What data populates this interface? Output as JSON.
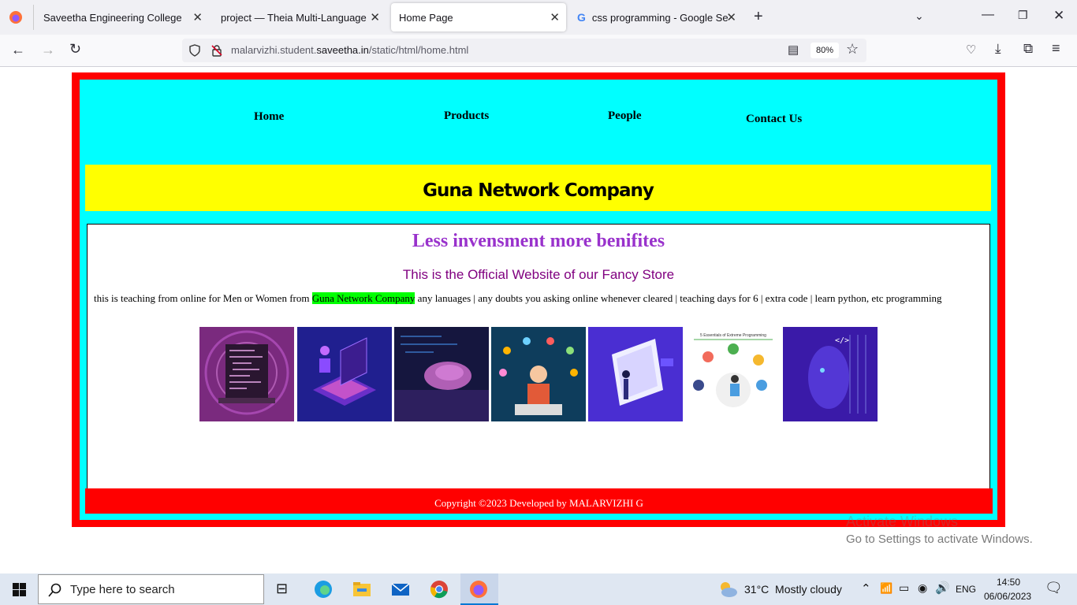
{
  "browser": {
    "tabs": [
      {
        "title": "Saveetha Engineering College",
        "active": false
      },
      {
        "title": "project — Theia Multi-Language Ex",
        "active": false
      },
      {
        "title": "Home Page",
        "active": true
      },
      {
        "title": "css programming - Google Sear",
        "active": false
      }
    ],
    "url_prefix": "malarvizhi.student.",
    "url_domain": "saveetha.in",
    "url_path": "/static/html/home.html",
    "zoom": "80%"
  },
  "page": {
    "nav": [
      "Home",
      "Products",
      "People",
      "Contact Us"
    ],
    "company_title": "Guna Network Company",
    "headline": "Less invensment more benifites",
    "subheadline": "This is the Official Website of our Fancy Store",
    "desc_before": "this is teaching from online for Men or Women from ",
    "desc_highlight": "Guna Network Company",
    "desc_after": " any lanuages | any doubts you asking online whenever cleared | teaching days for 6 | extra code | learn python, etc programming",
    "footer": "Copyright ©2023 Developed by MALARVIZHI G",
    "images": [
      "laptop-code-image",
      "isometric-laptop-image",
      "typing-hands-image",
      "developer-network-image",
      "tablet-illustration-image",
      "extreme-programming-image",
      "ai-face-image"
    ],
    "xp_image_title": "5 Essentials of Extreme Programming"
  },
  "watermark": {
    "line1": "Activate Windows",
    "line2": "Go to Settings to activate Windows."
  },
  "taskbar": {
    "search_placeholder": "Type here to search",
    "weather": "31°C  Mostly cloudy",
    "lang": "ENG",
    "time": "14:50",
    "date": "06/06/2023"
  }
}
